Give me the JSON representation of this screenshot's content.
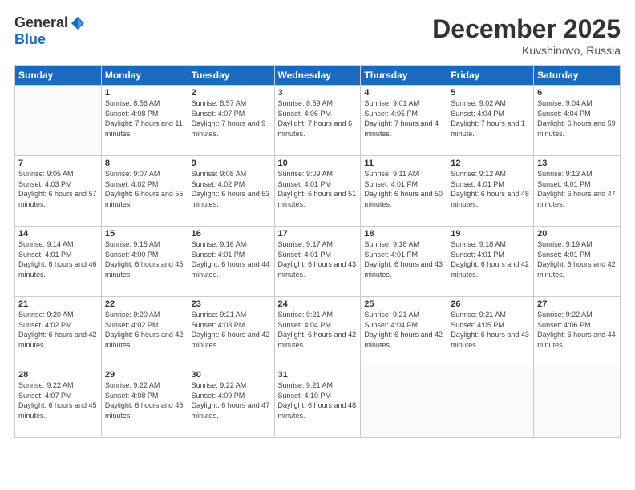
{
  "logo": {
    "general": "General",
    "blue": "Blue"
  },
  "header": {
    "month": "December 2025",
    "location": "Kuvshinovo, Russia"
  },
  "weekdays": [
    "Sunday",
    "Monday",
    "Tuesday",
    "Wednesday",
    "Thursday",
    "Friday",
    "Saturday"
  ],
  "weeks": [
    [
      {
        "day": "",
        "sunrise": "",
        "sunset": "",
        "daylight": ""
      },
      {
        "day": "1",
        "sunrise": "Sunrise: 8:56 AM",
        "sunset": "Sunset: 4:08 PM",
        "daylight": "Daylight: 7 hours and 11 minutes."
      },
      {
        "day": "2",
        "sunrise": "Sunrise: 8:57 AM",
        "sunset": "Sunset: 4:07 PM",
        "daylight": "Daylight: 7 hours and 9 minutes."
      },
      {
        "day": "3",
        "sunrise": "Sunrise: 8:59 AM",
        "sunset": "Sunset: 4:06 PM",
        "daylight": "Daylight: 7 hours and 6 minutes."
      },
      {
        "day": "4",
        "sunrise": "Sunrise: 9:01 AM",
        "sunset": "Sunset: 4:05 PM",
        "daylight": "Daylight: 7 hours and 4 minutes."
      },
      {
        "day": "5",
        "sunrise": "Sunrise: 9:02 AM",
        "sunset": "Sunset: 4:04 PM",
        "daylight": "Daylight: 7 hours and 1 minute."
      },
      {
        "day": "6",
        "sunrise": "Sunrise: 9:04 AM",
        "sunset": "Sunset: 4:04 PM",
        "daylight": "Daylight: 6 hours and 59 minutes."
      }
    ],
    [
      {
        "day": "7",
        "sunrise": "Sunrise: 9:05 AM",
        "sunset": "Sunset: 4:03 PM",
        "daylight": "Daylight: 6 hours and 57 minutes."
      },
      {
        "day": "8",
        "sunrise": "Sunrise: 9:07 AM",
        "sunset": "Sunset: 4:02 PM",
        "daylight": "Daylight: 6 hours and 55 minutes."
      },
      {
        "day": "9",
        "sunrise": "Sunrise: 9:08 AM",
        "sunset": "Sunset: 4:02 PM",
        "daylight": "Daylight: 6 hours and 53 minutes."
      },
      {
        "day": "10",
        "sunrise": "Sunrise: 9:09 AM",
        "sunset": "Sunset: 4:01 PM",
        "daylight": "Daylight: 6 hours and 51 minutes."
      },
      {
        "day": "11",
        "sunrise": "Sunrise: 9:11 AM",
        "sunset": "Sunset: 4:01 PM",
        "daylight": "Daylight: 6 hours and 50 minutes."
      },
      {
        "day": "12",
        "sunrise": "Sunrise: 9:12 AM",
        "sunset": "Sunset: 4:01 PM",
        "daylight": "Daylight: 6 hours and 48 minutes."
      },
      {
        "day": "13",
        "sunrise": "Sunrise: 9:13 AM",
        "sunset": "Sunset: 4:01 PM",
        "daylight": "Daylight: 6 hours and 47 minutes."
      }
    ],
    [
      {
        "day": "14",
        "sunrise": "Sunrise: 9:14 AM",
        "sunset": "Sunset: 4:01 PM",
        "daylight": "Daylight: 6 hours and 46 minutes."
      },
      {
        "day": "15",
        "sunrise": "Sunrise: 9:15 AM",
        "sunset": "Sunset: 4:00 PM",
        "daylight": "Daylight: 6 hours and 45 minutes."
      },
      {
        "day": "16",
        "sunrise": "Sunrise: 9:16 AM",
        "sunset": "Sunset: 4:01 PM",
        "daylight": "Daylight: 6 hours and 44 minutes."
      },
      {
        "day": "17",
        "sunrise": "Sunrise: 9:17 AM",
        "sunset": "Sunset: 4:01 PM",
        "daylight": "Daylight: 6 hours and 43 minutes."
      },
      {
        "day": "18",
        "sunrise": "Sunrise: 9:18 AM",
        "sunset": "Sunset: 4:01 PM",
        "daylight": "Daylight: 6 hours and 43 minutes."
      },
      {
        "day": "19",
        "sunrise": "Sunrise: 9:18 AM",
        "sunset": "Sunset: 4:01 PM",
        "daylight": "Daylight: 6 hours and 42 minutes."
      },
      {
        "day": "20",
        "sunrise": "Sunrise: 9:19 AM",
        "sunset": "Sunset: 4:01 PM",
        "daylight": "Daylight: 6 hours and 42 minutes."
      }
    ],
    [
      {
        "day": "21",
        "sunrise": "Sunrise: 9:20 AM",
        "sunset": "Sunset: 4:02 PM",
        "daylight": "Daylight: 6 hours and 42 minutes."
      },
      {
        "day": "22",
        "sunrise": "Sunrise: 9:20 AM",
        "sunset": "Sunset: 4:02 PM",
        "daylight": "Daylight: 6 hours and 42 minutes."
      },
      {
        "day": "23",
        "sunrise": "Sunrise: 9:21 AM",
        "sunset": "Sunset: 4:03 PM",
        "daylight": "Daylight: 6 hours and 42 minutes."
      },
      {
        "day": "24",
        "sunrise": "Sunrise: 9:21 AM",
        "sunset": "Sunset: 4:04 PM",
        "daylight": "Daylight: 6 hours and 42 minutes."
      },
      {
        "day": "25",
        "sunrise": "Sunrise: 9:21 AM",
        "sunset": "Sunset: 4:04 PM",
        "daylight": "Daylight: 6 hours and 42 minutes."
      },
      {
        "day": "26",
        "sunrise": "Sunrise: 9:21 AM",
        "sunset": "Sunset: 4:05 PM",
        "daylight": "Daylight: 6 hours and 43 minutes."
      },
      {
        "day": "27",
        "sunrise": "Sunrise: 9:22 AM",
        "sunset": "Sunset: 4:06 PM",
        "daylight": "Daylight: 6 hours and 44 minutes."
      }
    ],
    [
      {
        "day": "28",
        "sunrise": "Sunrise: 9:22 AM",
        "sunset": "Sunset: 4:07 PM",
        "daylight": "Daylight: 6 hours and 45 minutes."
      },
      {
        "day": "29",
        "sunrise": "Sunrise: 9:22 AM",
        "sunset": "Sunset: 4:08 PM",
        "daylight": "Daylight: 6 hours and 46 minutes."
      },
      {
        "day": "30",
        "sunrise": "Sunrise: 9:22 AM",
        "sunset": "Sunset: 4:09 PM",
        "daylight": "Daylight: 6 hours and 47 minutes."
      },
      {
        "day": "31",
        "sunrise": "Sunrise: 9:21 AM",
        "sunset": "Sunset: 4:10 PM",
        "daylight": "Daylight: 6 hours and 48 minutes."
      },
      {
        "day": "",
        "sunrise": "",
        "sunset": "",
        "daylight": ""
      },
      {
        "day": "",
        "sunrise": "",
        "sunset": "",
        "daylight": ""
      },
      {
        "day": "",
        "sunrise": "",
        "sunset": "",
        "daylight": ""
      }
    ]
  ]
}
